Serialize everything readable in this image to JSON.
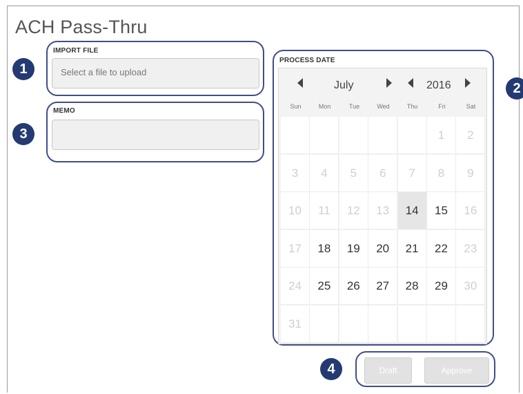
{
  "page": {
    "title": "ACH Pass-Thru"
  },
  "import_file": {
    "label": "IMPORT FILE",
    "placeholder": "Select a file to upload"
  },
  "memo": {
    "label": "MEMO",
    "value": ""
  },
  "process_date": {
    "label": "PROCESS DATE",
    "month": "July",
    "year": "2016",
    "weekdays": [
      "Sun",
      "Mon",
      "Tue",
      "Wed",
      "Thu",
      "Fri",
      "Sat"
    ],
    "weeks": [
      [
        {
          "d": ""
        },
        {
          "d": ""
        },
        {
          "d": ""
        },
        {
          "d": ""
        },
        {
          "d": ""
        },
        {
          "d": "1",
          "s": "dim"
        },
        {
          "d": "2",
          "s": "dim"
        }
      ],
      [
        {
          "d": "3",
          "s": "dim"
        },
        {
          "d": "4",
          "s": "dim"
        },
        {
          "d": "5",
          "s": "dim"
        },
        {
          "d": "6",
          "s": "dim"
        },
        {
          "d": "7",
          "s": "dim"
        },
        {
          "d": "8",
          "s": "dim"
        },
        {
          "d": "9",
          "s": "dim"
        }
      ],
      [
        {
          "d": "10",
          "s": "dim"
        },
        {
          "d": "11",
          "s": "dim"
        },
        {
          "d": "12",
          "s": "dim"
        },
        {
          "d": "13",
          "s": "dim"
        },
        {
          "d": "14",
          "s": "today"
        },
        {
          "d": "15",
          "s": "active"
        },
        {
          "d": "16",
          "s": "dim"
        }
      ],
      [
        {
          "d": "17",
          "s": "dim"
        },
        {
          "d": "18",
          "s": "active"
        },
        {
          "d": "19",
          "s": "active"
        },
        {
          "d": "20",
          "s": "active"
        },
        {
          "d": "21",
          "s": "active"
        },
        {
          "d": "22",
          "s": "active"
        },
        {
          "d": "23",
          "s": "dim"
        }
      ],
      [
        {
          "d": "24",
          "s": "dim"
        },
        {
          "d": "25",
          "s": "active"
        },
        {
          "d": "26",
          "s": "active"
        },
        {
          "d": "27",
          "s": "active"
        },
        {
          "d": "28",
          "s": "active"
        },
        {
          "d": "29",
          "s": "active"
        },
        {
          "d": "30",
          "s": "dim"
        }
      ],
      [
        {
          "d": "31",
          "s": "dim"
        },
        {
          "d": ""
        },
        {
          "d": ""
        },
        {
          "d": ""
        },
        {
          "d": ""
        },
        {
          "d": ""
        },
        {
          "d": ""
        }
      ]
    ]
  },
  "actions": {
    "draft_label": "Draft",
    "approve_label": "Approve"
  },
  "markers": {
    "m1": "1",
    "m2": "2",
    "m3": "3",
    "m4": "4"
  },
  "colors": {
    "marker": "#243a73",
    "group_outline": "#3f4d8c"
  }
}
